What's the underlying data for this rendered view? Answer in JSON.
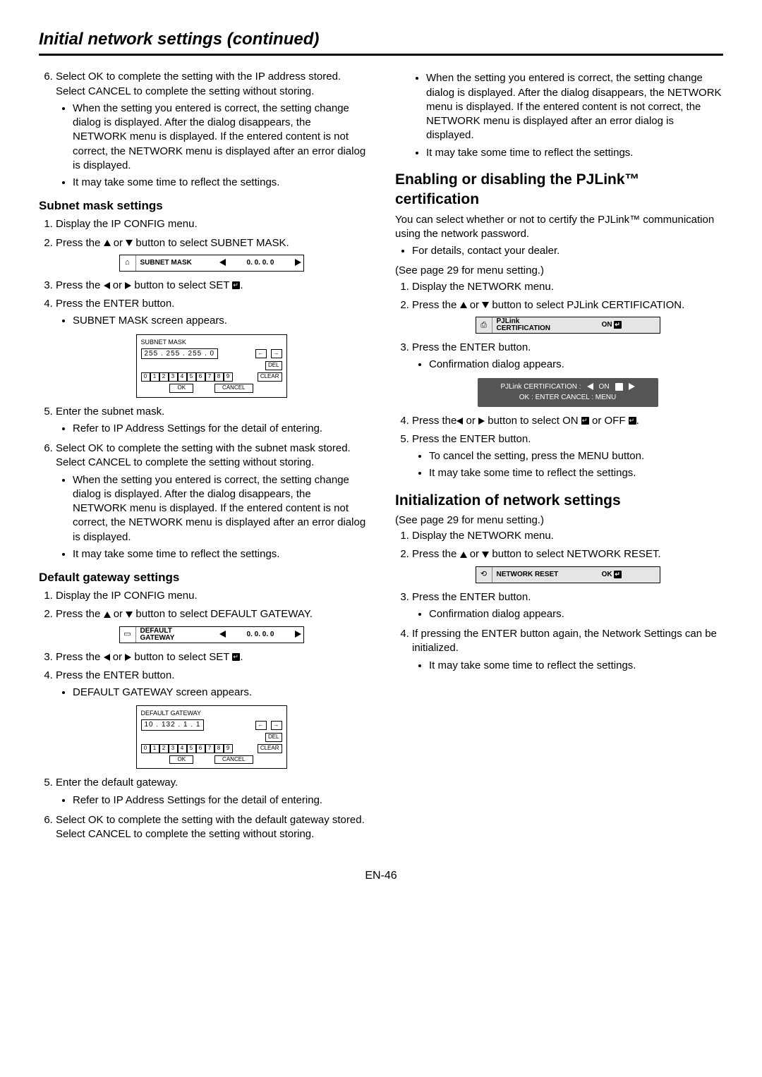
{
  "page_title": "Initial network settings (continued)",
  "page_number": "EN-46",
  "left": {
    "step6": "Select OK to complete the setting with the IP address stored. Select CANCEL to complete the setting without storing.",
    "step6_b1": "When the setting you entered is correct, the setting change dialog is displayed. After the dialog disappears, the NETWORK menu is displayed. If the entered content is not correct, the NETWORK menu is displayed after an error dialog is displayed.",
    "step6_b2": "It may take some time to reflect the settings.",
    "subnet_heading": "Subnet mask settings",
    "subnet_s1": "Display the IP CONFIG menu.",
    "subnet_s2_a": "Press the ",
    "subnet_s2_b": " or ",
    "subnet_s2_c": " button to select SUBNET MASK.",
    "subnet_bar_label": "SUBNET MASK",
    "subnet_bar_value": "0. 0. 0. 0",
    "subnet_s3_a": "Press the ",
    "subnet_s3_b": " or ",
    "subnet_s3_c": " button to select SET ",
    "subnet_s3_d": ".",
    "subnet_s4": "Press the ENTER button.",
    "subnet_s4_b1": "SUBNET MASK screen appears.",
    "subnet_editor_title": "SUBNET MASK",
    "subnet_editor_value": "255 . 255 . 255 .    0",
    "del": "DEL",
    "clear": "CLEAR",
    "ok": "OK",
    "cancel": "CANCEL",
    "subnet_s5": "Enter the subnet mask.",
    "subnet_s5_b1": "Refer to IP Address Settings for the detail of entering.",
    "subnet_s6": "Select OK to complete the setting with the subnet mask stored. Select CANCEL to complete the setting without storing.",
    "subnet_s6_b1": "When the setting you entered is correct, the setting change dialog is displayed. After the dialog disappears, the NETWORK menu is displayed. If the entered content is not correct, the NETWORK menu is displayed after an error dialog is displayed.",
    "subnet_s6_b2": "It may take some time to reflect the settings.",
    "gateway_heading": "Default gateway settings",
    "gateway_s1": "Display the IP CONFIG menu.",
    "gateway_s2_a": "Press the ",
    "gateway_s2_b": " or ",
    "gateway_s2_c": " button to select DEFAULT GATEWAY.",
    "gateway_bar_label": "DEFAULT\nGATEWAY",
    "gateway_bar_value": "0. 0. 0. 0",
    "gateway_s3_a": "Press the ",
    "gateway_s3_b": " or ",
    "gateway_s3_c": " button to select SET ",
    "gateway_s3_d": ".",
    "gateway_s4": "Press the ENTER button.",
    "gateway_s4_b1": "DEFAULT GATEWAY screen appears.",
    "gateway_editor_title": "DEFAULT GATEWAY",
    "gateway_editor_value": " 10 . 132 .    1 .    1",
    "gateway_s5": "Enter the default gateway.",
    "gateway_s5_b1": "Refer to IP Address Settings for the detail of entering.",
    "gateway_s6": "Select OK to complete the setting with the default gateway stored. Select CANCEL to complete the setting without storing."
  },
  "right": {
    "top_b1": "When the setting you entered is correct, the setting change dialog is displayed. After the dialog disappears, the NETWORK menu is displayed. If the entered content is not correct, the NETWORK menu is displayed after an error dialog is displayed.",
    "top_b2": "It may take some time to reflect the settings.",
    "pjlink_heading": "Enabling or disabling the PJLink™ certification",
    "pjlink_intro": "You can select whether or not to certify the PJLink™ communication using the network password.",
    "pjlink_intro_b1": "For details, contact your dealer.",
    "pjlink_see": "(See page 29 for menu setting.)",
    "pjlink_s1": "Display the NETWORK menu.",
    "pjlink_s2_a": "Press the ",
    "pjlink_s2_b": " or ",
    "pjlink_s2_c": " button to select PJLink CERTIFICATION.",
    "pjlink_bar_label": "PJLink\nCERTIFICATION",
    "pjlink_bar_value": "ON",
    "pjlink_s3": "Press the ENTER button.",
    "pjlink_s3_b1": "Confirmation dialog appears.",
    "confirm_label": "PJLink CERTIFICATION :",
    "confirm_value": "ON",
    "confirm_hint": "OK : ENTER   CANCEL : MENU",
    "pjlink_s4_a": "Press the",
    "pjlink_s4_b": " or ",
    "pjlink_s4_c": " button to select ON ",
    "pjlink_s4_d": " or OFF ",
    "pjlink_s4_e": ".",
    "pjlink_s5": "Press the ENTER button.",
    "pjlink_s5_b1": "To cancel the setting, press the MENU button.",
    "pjlink_s5_b2": "It may take some time to reflect the settings.",
    "init_heading": "Initialization of network settings",
    "init_see": "(See page 29 for menu setting.)",
    "init_s1": "Display the NETWORK menu.",
    "init_s2_a": "Press the ",
    "init_s2_b": " or ",
    "init_s2_c": " button to select NETWORK RESET.",
    "reset_bar_label": "NETWORK RESET",
    "reset_bar_value": "OK",
    "init_s3": "Press the ENTER button.",
    "init_s3_b1": "Confirmation dialog appears.",
    "init_s4": "If pressing the ENTER button again, the Network Settings can be initialized.",
    "init_s4_b1": "It may take some time to reflect the settings."
  },
  "digits": [
    "0",
    "1",
    "2",
    "3",
    "4",
    "5",
    "6",
    "7",
    "8",
    "9"
  ]
}
